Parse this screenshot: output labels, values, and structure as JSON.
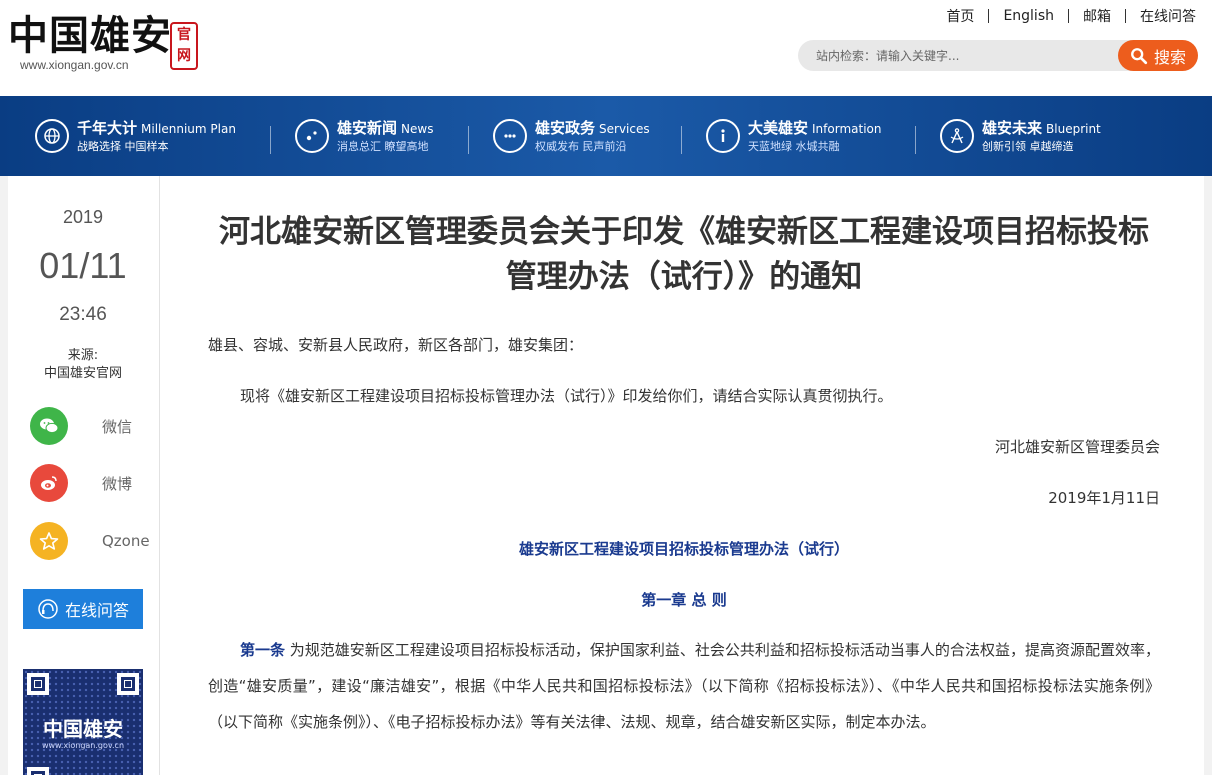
{
  "header": {
    "logo_text": "中国雄安",
    "logo_url": "www.xiongan.gov.cn",
    "logo_seal": "官网",
    "topnav": [
      "首页",
      "English",
      "邮箱",
      "在线问答"
    ],
    "search_placeholder": "站内检索：请输入关键字...",
    "search_label": "搜索"
  },
  "mainnav": [
    {
      "title": "千年大计",
      "en": "Millennium Plan",
      "sub": "战略选择 中国样本",
      "icon": "globe-icon"
    },
    {
      "title": "雄安新闻",
      "en": "News",
      "sub": "消息总汇 瞭望高地",
      "icon": "news-icon"
    },
    {
      "title": "雄安政务",
      "en": "Services",
      "sub": "权威发布 民声前沿",
      "icon": "chat-icon"
    },
    {
      "title": "大美雄安",
      "en": "Information",
      "sub": "天蓝地绿 水城共融",
      "icon": "info-icon"
    },
    {
      "title": "雄安未来",
      "en": "Blueprint",
      "sub": "创新引领 卓越缔造",
      "icon": "blueprint-icon"
    }
  ],
  "rail": {
    "year": "2019",
    "month_day": "01/11",
    "time": "23:46",
    "source_label": "来源:",
    "source_value": "中国雄安官网",
    "share": [
      "微信",
      "微博",
      "Qzone"
    ],
    "qa_label": "在线问答",
    "qr_brand": "中国雄安",
    "qr_url": "www.xiongan.gov.cn",
    "colors": {
      "wechat": "#3fb549",
      "weibo": "#e8493c",
      "qzone": "#f5b323",
      "qa": "#1e7fdb"
    }
  },
  "article": {
    "title": "河北雄安新区管理委员会关于印发《雄安新区工程建设项目招标投标管理办法（试行）》的通知",
    "address": "雄县、容城、安新县人民政府，新区各部门，雄安集团：",
    "intro": "现将《雄安新区工程建设项目招标投标管理办法（试行）》印发给你们，请结合实际认真贯彻执行。",
    "signature": "河北雄安新区管理委员会",
    "date": "2019年1月11日",
    "subtitle": "雄安新区工程建设项目招标投标管理办法（试行）",
    "chapter": "第一章 总 则",
    "article1_label": "第一条",
    "article1_text": " 为规范雄安新区工程建设项目招标投标活动，保护国家利益、社会公共利益和招标投标活动当事人的合法权益，提高资源配置效率，创造“雄安质量”，建设“廉洁雄安”，根据《中华人民共和国招标投标法》（以下简称《招标投标法》）、《中华人民共和国招标投标法实施条例》（以下简称《实施条例》）、《电子招标投标办法》等有关法律、法规、规章，结合雄安新区实际，制定本办法。"
  }
}
